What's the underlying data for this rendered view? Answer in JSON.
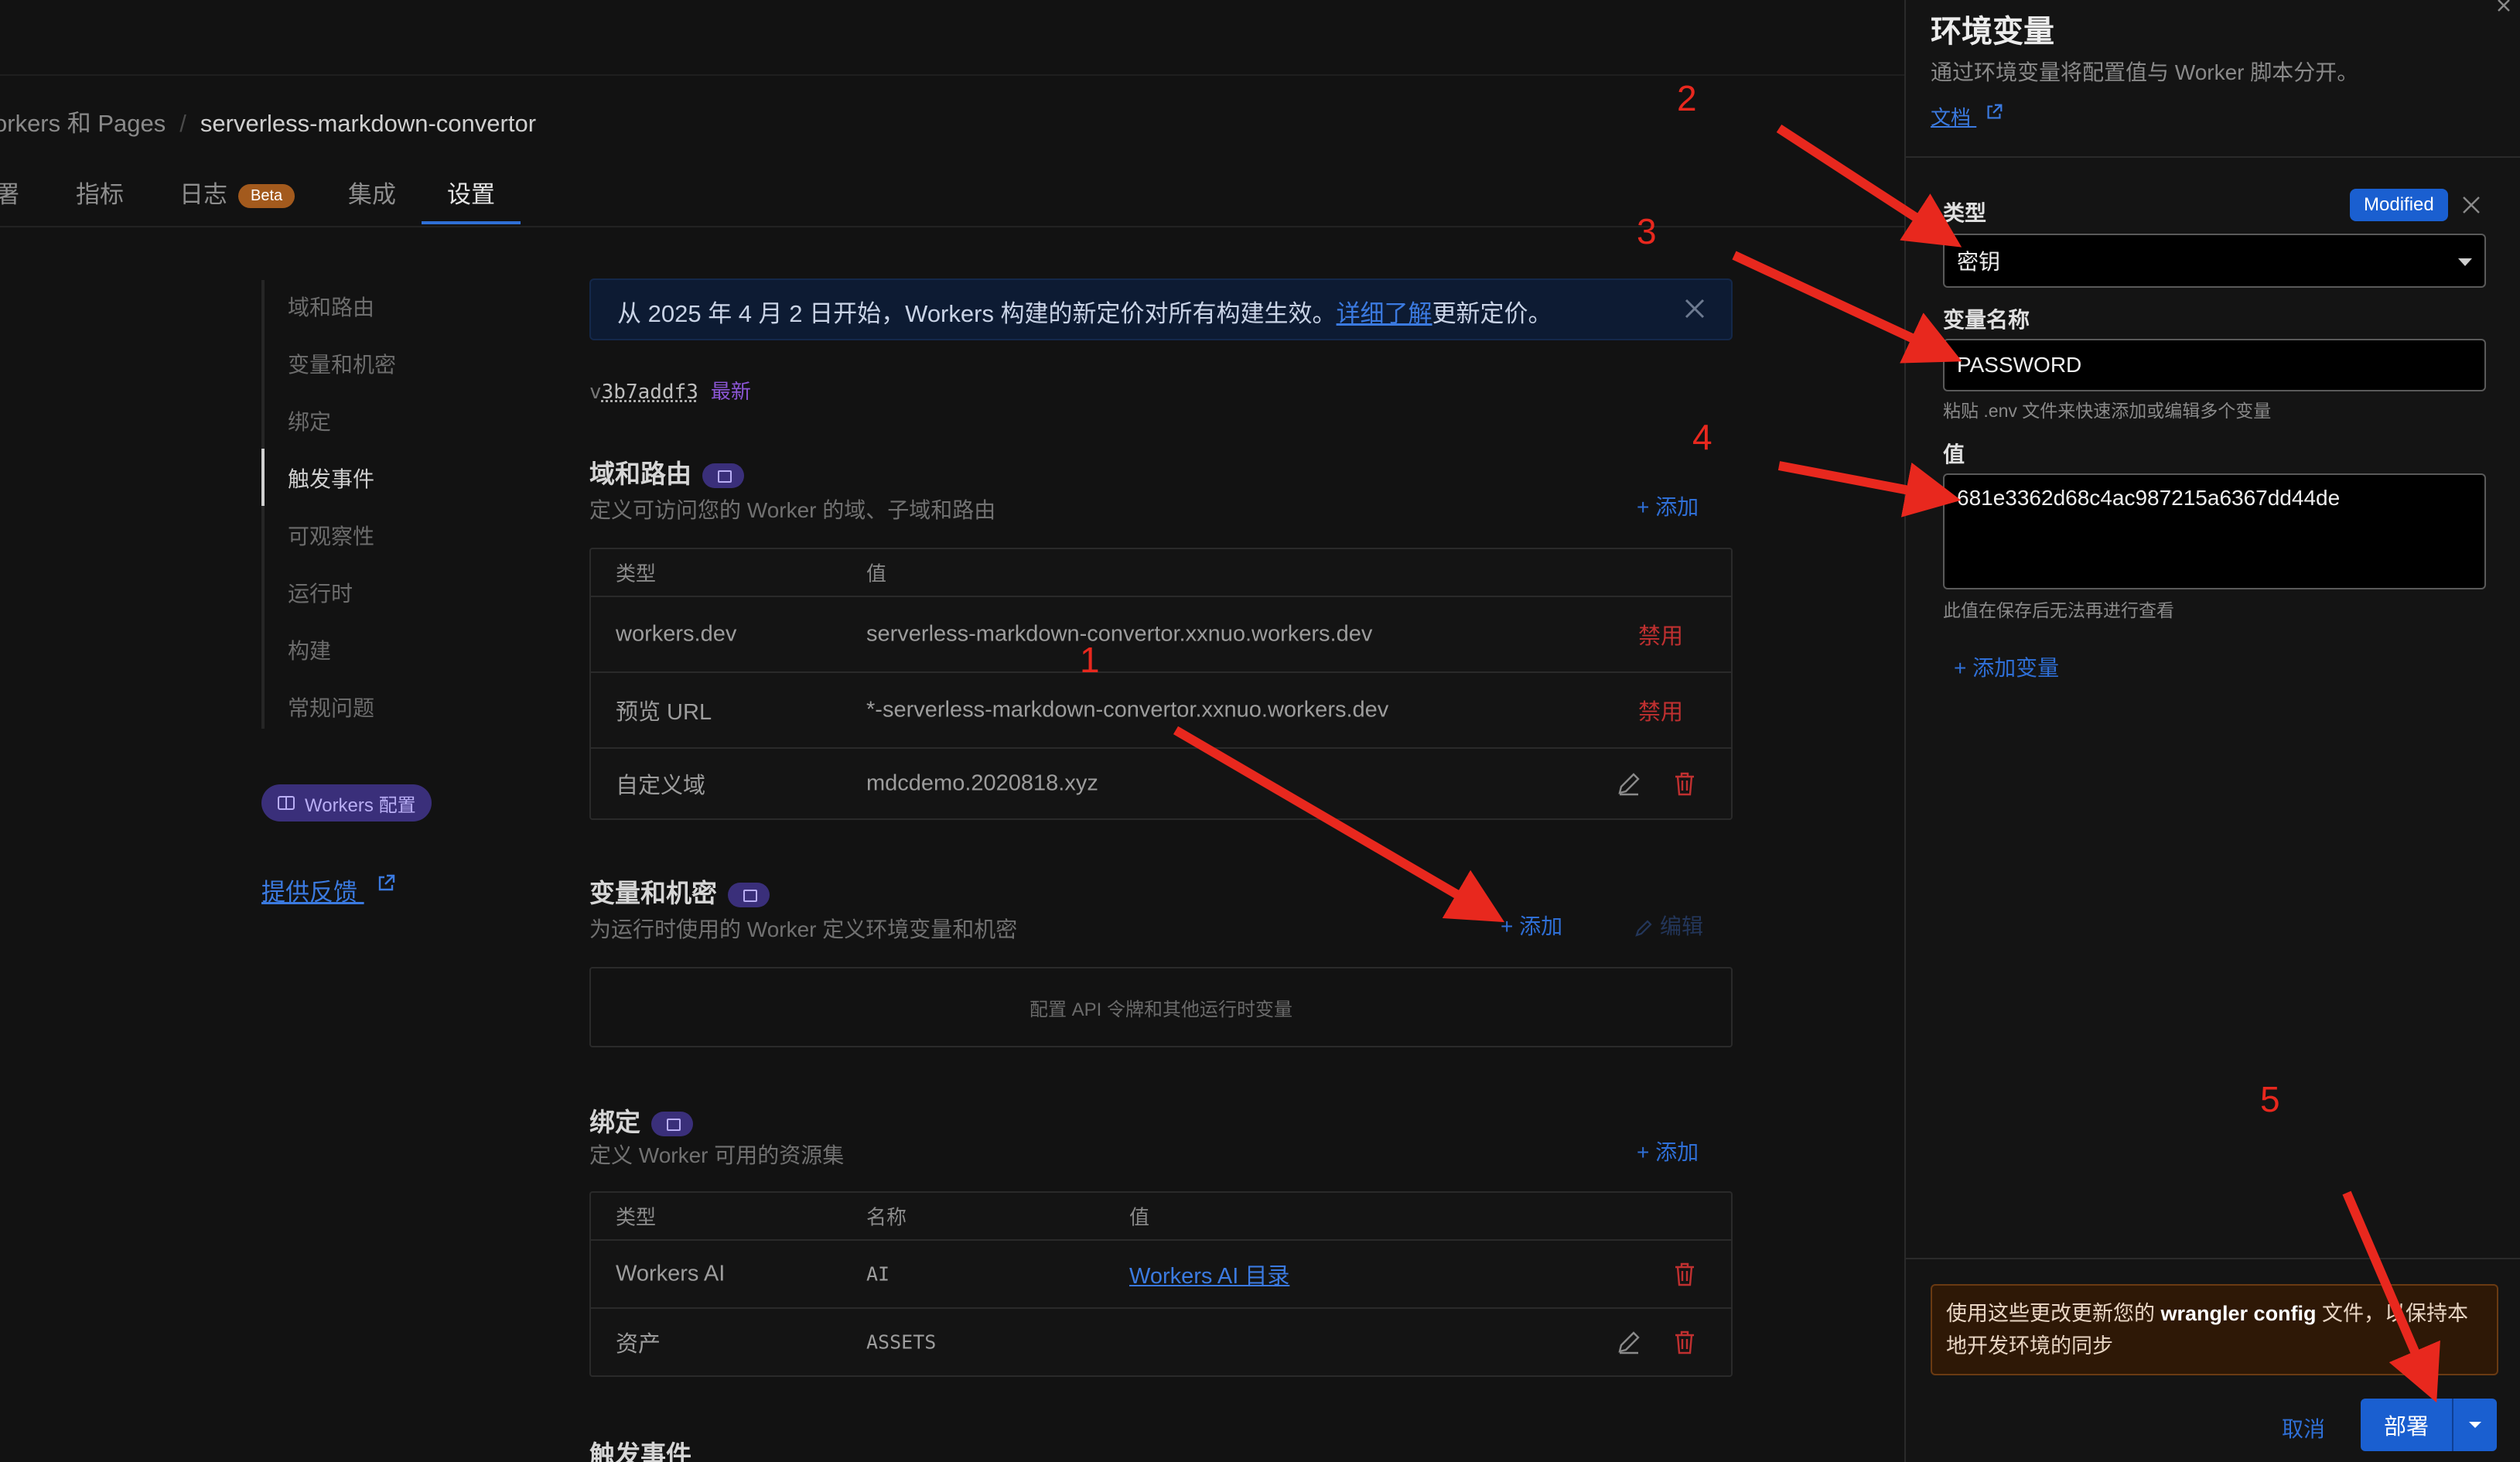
{
  "breadcrumb": {
    "parent": "orkers 和 Pages",
    "separator": "/",
    "current": "serverless-markdown-convertor"
  },
  "tabs": [
    {
      "label": "署"
    },
    {
      "label": "指标"
    },
    {
      "label": "日志",
      "badge": "Beta"
    },
    {
      "label": "集成"
    },
    {
      "label": "设置",
      "active": true
    }
  ],
  "sidenav": {
    "items": [
      "域和路由",
      "变量和机密",
      "绑定",
      "触发事件",
      "可观察性",
      "运行时",
      "构建",
      "常规问题"
    ],
    "active": "触发事件",
    "config_pill": "Workers 配置",
    "feedback": "提供反馈"
  },
  "banner": {
    "text_before": "从 2025 年 4 月 2 日开始，Workers 构建的新定价对所有构建生效。",
    "link": "详细了解",
    "text_after": "更新定价。"
  },
  "version": {
    "id": "3b7addf3",
    "prefix": "v",
    "tag": "最新"
  },
  "domains": {
    "title": "域和路由",
    "subtitle": "定义可访问您的 Worker 的域、子域和路由",
    "add": "+ 添加",
    "columns": [
      "类型",
      "值"
    ],
    "rows": [
      {
        "type": "workers.dev",
        "value": "serverless-markdown-convertor.xxnuo.workers.dev",
        "action": "禁用"
      },
      {
        "type": "预览 URL",
        "value": "*-serverless-markdown-convertor.xxnuo.workers.dev",
        "action": "禁用"
      },
      {
        "type": "自定义域",
        "value": "mdcdemo.2020818.xyz"
      }
    ]
  },
  "variables": {
    "title": "变量和机密",
    "subtitle": "为运行时使用的 Worker 定义环境变量和机密",
    "add": "+ 添加",
    "edit": "编辑",
    "empty": "配置 API 令牌和其他运行时变量"
  },
  "bindings": {
    "title": "绑定",
    "subtitle": "定义 Worker 可用的资源集",
    "add": "+ 添加",
    "columns": [
      "类型",
      "名称",
      "值"
    ],
    "rows": [
      {
        "type": "Workers AI",
        "name": "AI",
        "value": "Workers AI 目录"
      },
      {
        "type": "资产",
        "name": "ASSETS",
        "value": ""
      }
    ]
  },
  "triggers": {
    "title": "触发事件"
  },
  "drawer": {
    "title": "环境变量",
    "subtitle": "通过环境变量将配置值与 Worker 脚本分开。",
    "doc_link": "文档",
    "type_label": "类型",
    "modified_badge": "Modified",
    "type_value": "密钥",
    "name_label": "变量名称",
    "name_value": "PASSWORD",
    "name_hint": "粘贴 .env 文件来快速添加或编辑多个变量",
    "value_label": "值",
    "value_value": "681e3362d68c4ac987215a6367dd44de",
    "value_hint": "此值在保存后无法再进行查看",
    "add_variable": "+ 添加变量",
    "warning_before": "使用这些更改更新您的 ",
    "warning_bold": "wrangler config",
    "warning_after": " 文件，以保持本地开发环境的同步",
    "cancel": "取消",
    "deploy": "部署"
  },
  "annotations": [
    "1",
    "2",
    "3",
    "4",
    "5"
  ],
  "colors": {
    "accent": "#1a5fd0",
    "link": "#3b7ae0",
    "danger": "#c03030",
    "annotation": "#e8281e",
    "badge_purple": "#3a2f7a"
  }
}
